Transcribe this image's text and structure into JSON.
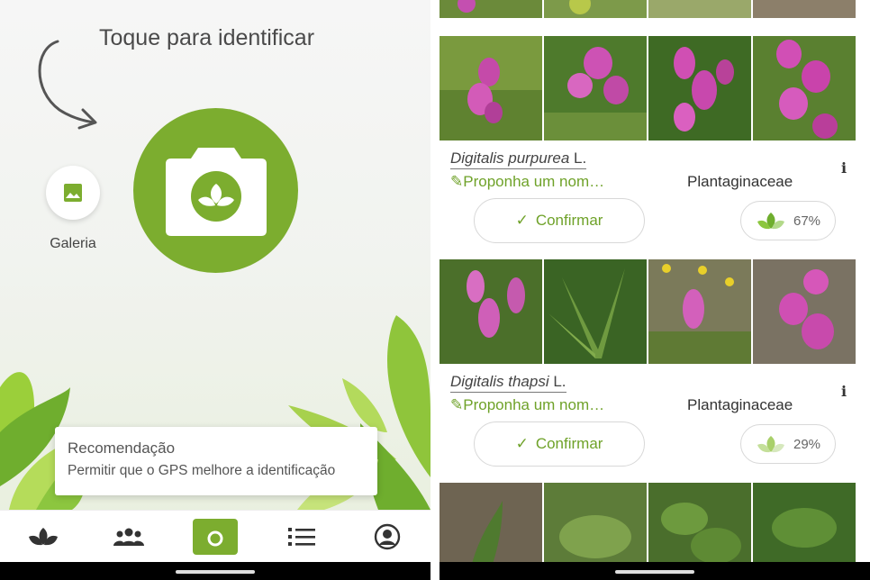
{
  "left": {
    "hint": "Toque para identificar",
    "gallery_label": "Galeria",
    "toast_title": "Recomendação",
    "toast_body": "Permitir que o GPS melhore a identificação",
    "nav": [
      "home",
      "community",
      "camera",
      "list",
      "profile"
    ]
  },
  "right": {
    "results": [
      {
        "genus_species": "Digitalis purpurea",
        "author": "L.",
        "suggest": "Proponha um nom…",
        "family": "Plantaginaceae",
        "confirm": "Confirmar",
        "score": "67%"
      },
      {
        "genus_species": "Digitalis thapsi",
        "author": "L.",
        "suggest": "Proponha um nom…",
        "family": "Plantaginaceae",
        "confirm": "Confirmar",
        "score": "29%"
      }
    ]
  },
  "colors": {
    "accent": "#7cad2f",
    "link": "#6fa229"
  }
}
